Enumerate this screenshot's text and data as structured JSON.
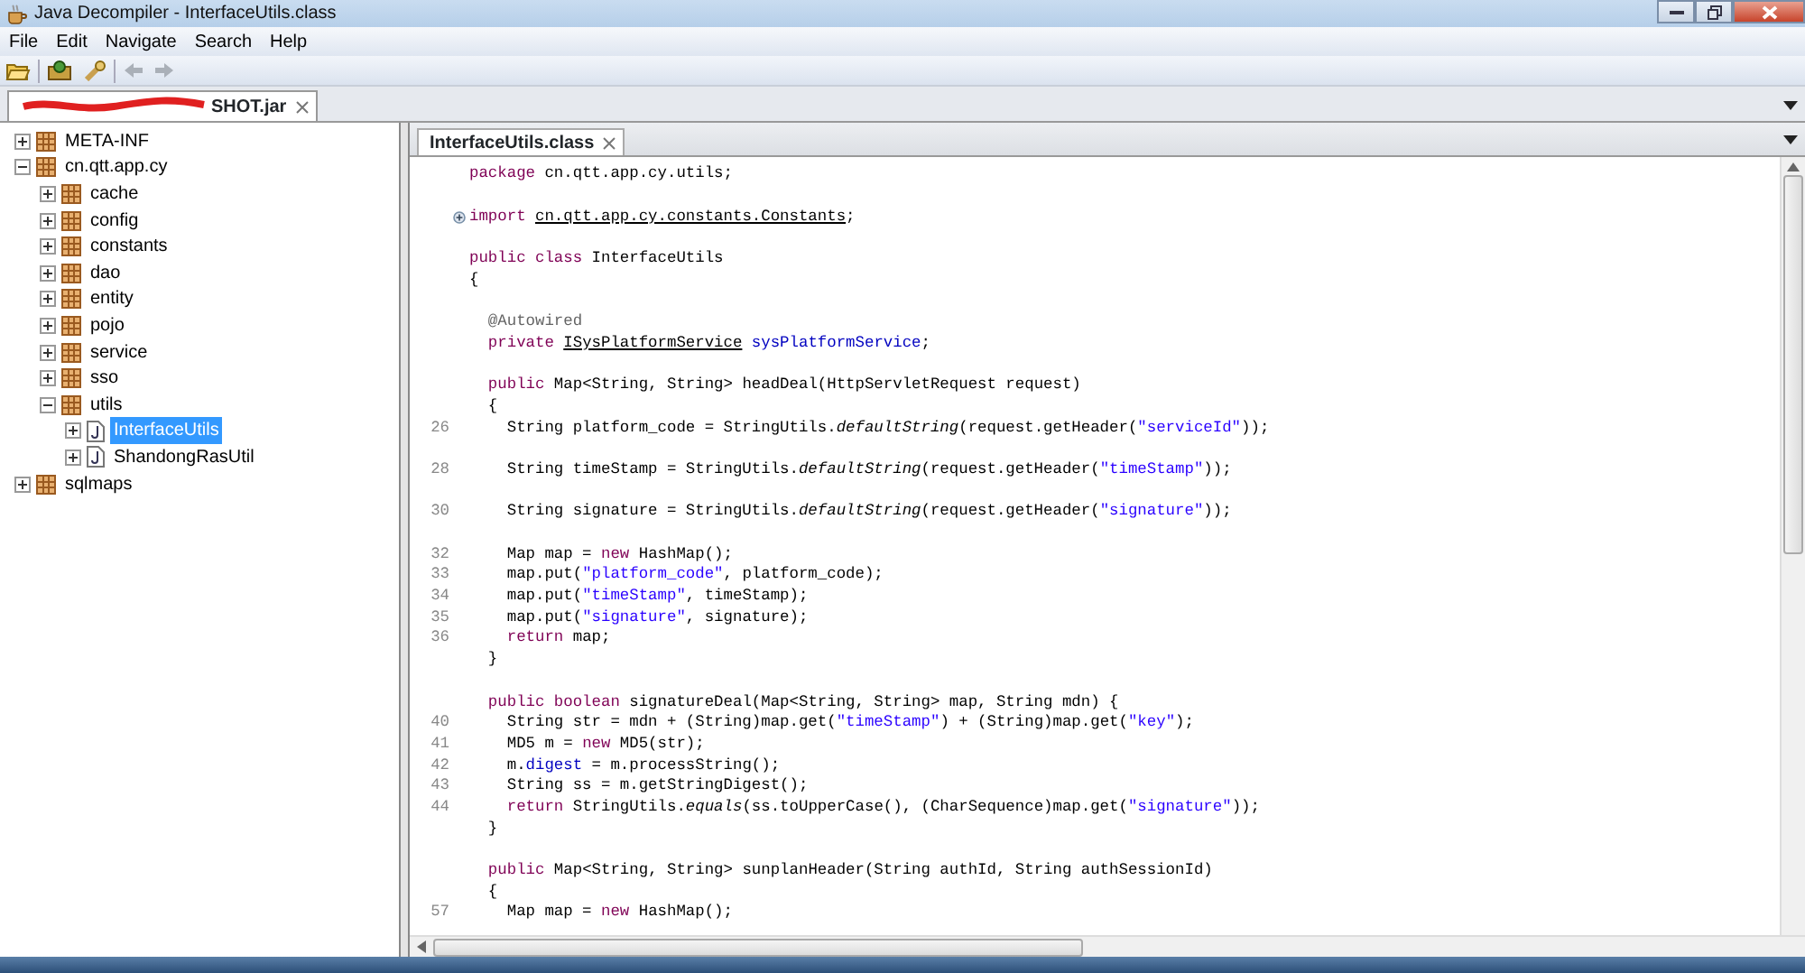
{
  "window": {
    "title": "Java Decompiler - InterfaceUtils.class"
  },
  "menu": [
    "File",
    "Edit",
    "Navigate",
    "Search",
    "Help"
  ],
  "archive_tab": {
    "label": "SHOT.jar",
    "selected": true
  },
  "tree": [
    {
      "label": "META-INF",
      "kind": "package",
      "expanded": false,
      "selected": false
    },
    {
      "label": "cn.qtt.app.cy",
      "kind": "package",
      "expanded": true,
      "selected": false,
      "children": [
        {
          "label": "cache",
          "kind": "package",
          "expanded": false,
          "selected": false
        },
        {
          "label": "config",
          "kind": "package",
          "expanded": false,
          "selected": false
        },
        {
          "label": "constants",
          "kind": "package",
          "expanded": false,
          "selected": false
        },
        {
          "label": "dao",
          "kind": "package",
          "expanded": false,
          "selected": false
        },
        {
          "label": "entity",
          "kind": "package",
          "expanded": false,
          "selected": false
        },
        {
          "label": "pojo",
          "kind": "package",
          "expanded": false,
          "selected": false
        },
        {
          "label": "service",
          "kind": "package",
          "expanded": false,
          "selected": false
        },
        {
          "label": "sso",
          "kind": "package",
          "expanded": false,
          "selected": false
        },
        {
          "label": "utils",
          "kind": "package",
          "expanded": true,
          "selected": false,
          "children": [
            {
              "label": "InterfaceUtils",
              "kind": "class",
              "expanded": false,
              "selected": true
            },
            {
              "label": "ShandongRasUtil",
              "kind": "class",
              "expanded": false,
              "selected": false
            }
          ]
        }
      ]
    },
    {
      "label": "sqlmaps",
      "kind": "package",
      "expanded": false,
      "selected": false
    }
  ],
  "editor_tab": {
    "label": "InterfaceUtils.class",
    "selected": true
  },
  "code_lines": [
    {
      "kind": "code",
      "segments": [
        {
          "kind": "keyword",
          "text": "package"
        },
        {
          "kind": "plain",
          "text": " cn.qtt.app.cy.utils;"
        }
      ]
    },
    {
      "kind": "blank"
    },
    {
      "kind": "folded",
      "segments": [
        {
          "kind": "keyword",
          "text": "import "
        },
        {
          "kind": "reference",
          "text": "cn.qtt.app.cy.constants.Constants"
        },
        {
          "kind": "plain",
          "text": ";"
        }
      ]
    },
    {
      "kind": "blank"
    },
    {
      "kind": "code",
      "segments": [
        {
          "kind": "keyword",
          "text": "public class"
        },
        {
          "kind": "plain",
          "text": " InterfaceUtils"
        }
      ]
    },
    {
      "kind": "code",
      "segments": [
        {
          "kind": "plain",
          "text": "{"
        }
      ]
    },
    {
      "kind": "blank"
    },
    {
      "kind": "code",
      "segments": [
        {
          "kind": "annotation",
          "text": "  @Autowired"
        }
      ]
    },
    {
      "kind": "code",
      "segments": [
        {
          "kind": "keyword",
          "text": "  private "
        },
        {
          "kind": "reference",
          "text": "ISysPlatformService"
        },
        {
          "kind": "field",
          "text": " sysPlatformService"
        },
        {
          "kind": "plain",
          "text": ";"
        }
      ]
    },
    {
      "kind": "blank"
    },
    {
      "kind": "code",
      "segments": [
        {
          "kind": "keyword",
          "text": "  public"
        },
        {
          "kind": "plain",
          "text": " Map<String, String> headDeal(HttpServletRequest request)"
        }
      ]
    },
    {
      "kind": "code",
      "segments": [
        {
          "kind": "plain",
          "text": "  {"
        }
      ]
    },
    {
      "kind": "code",
      "number": "26",
      "segments": [
        {
          "kind": "plain",
          "text": "    String platform_code = StringUtils."
        },
        {
          "kind": "static",
          "text": "defaultString"
        },
        {
          "kind": "plain",
          "text": "(request.getHeader("
        },
        {
          "kind": "string",
          "text": "\"serviceId\""
        },
        {
          "kind": "plain",
          "text": "));"
        }
      ]
    },
    {
      "kind": "blank"
    },
    {
      "kind": "code",
      "number": "28",
      "segments": [
        {
          "kind": "plain",
          "text": "    String timeStamp = StringUtils."
        },
        {
          "kind": "static",
          "text": "defaultString"
        },
        {
          "kind": "plain",
          "text": "(request.getHeader("
        },
        {
          "kind": "string",
          "text": "\"timeStamp\""
        },
        {
          "kind": "plain",
          "text": "));"
        }
      ]
    },
    {
      "kind": "blank"
    },
    {
      "kind": "code",
      "number": "30",
      "segments": [
        {
          "kind": "plain",
          "text": "    String signature = StringUtils."
        },
        {
          "kind": "static",
          "text": "defaultString"
        },
        {
          "kind": "plain",
          "text": "(request.getHeader("
        },
        {
          "kind": "string",
          "text": "\"signature\""
        },
        {
          "kind": "plain",
          "text": "));"
        }
      ]
    },
    {
      "kind": "blank"
    },
    {
      "kind": "code",
      "number": "32",
      "segments": [
        {
          "kind": "plain",
          "text": "    Map map = "
        },
        {
          "kind": "keyword",
          "text": "new"
        },
        {
          "kind": "plain",
          "text": " HashMap();"
        }
      ]
    },
    {
      "kind": "code",
      "number": "33",
      "segments": [
        {
          "kind": "plain",
          "text": "    map.put("
        },
        {
          "kind": "string",
          "text": "\"platform_code\""
        },
        {
          "kind": "plain",
          "text": ", platform_code);"
        }
      ]
    },
    {
      "kind": "code",
      "number": "34",
      "segments": [
        {
          "kind": "plain",
          "text": "    map.put("
        },
        {
          "kind": "string",
          "text": "\"timeStamp\""
        },
        {
          "kind": "plain",
          "text": ", timeStamp);"
        }
      ]
    },
    {
      "kind": "code",
      "number": "35",
      "segments": [
        {
          "kind": "plain",
          "text": "    map.put("
        },
        {
          "kind": "string",
          "text": "\"signature\""
        },
        {
          "kind": "plain",
          "text": ", signature);"
        }
      ]
    },
    {
      "kind": "code",
      "number": "36",
      "segments": [
        {
          "kind": "keyword",
          "text": "    return"
        },
        {
          "kind": "plain",
          "text": " map;"
        }
      ]
    },
    {
      "kind": "code",
      "segments": [
        {
          "kind": "plain",
          "text": "  }"
        }
      ]
    },
    {
      "kind": "blank"
    },
    {
      "kind": "code",
      "segments": [
        {
          "kind": "keyword",
          "text": "  public boolean"
        },
        {
          "kind": "plain",
          "text": " signatureDeal(Map<String, String> map, String mdn) {"
        }
      ]
    },
    {
      "kind": "code",
      "number": "40",
      "segments": [
        {
          "kind": "plain",
          "text": "    String str = mdn + (String)map.get("
        },
        {
          "kind": "string",
          "text": "\"timeStamp\""
        },
        {
          "kind": "plain",
          "text": ") + (String)map.get("
        },
        {
          "kind": "string",
          "text": "\"key\""
        },
        {
          "kind": "plain",
          "text": ");"
        }
      ]
    },
    {
      "kind": "code",
      "number": "41",
      "segments": [
        {
          "kind": "plain",
          "text": "    MD5 m = "
        },
        {
          "kind": "keyword",
          "text": "new"
        },
        {
          "kind": "plain",
          "text": " MD5(str);"
        }
      ]
    },
    {
      "kind": "code",
      "number": "42",
      "segments": [
        {
          "kind": "plain",
          "text": "    m."
        },
        {
          "kind": "field",
          "text": "digest"
        },
        {
          "kind": "plain",
          "text": " = m.processString();"
        }
      ]
    },
    {
      "kind": "code",
      "number": "43",
      "segments": [
        {
          "kind": "plain",
          "text": "    String ss = m.getStringDigest();"
        }
      ]
    },
    {
      "kind": "code",
      "number": "44",
      "segments": [
        {
          "kind": "keyword",
          "text": "    return"
        },
        {
          "kind": "plain",
          "text": " StringUtils."
        },
        {
          "kind": "static",
          "text": "equals"
        },
        {
          "kind": "plain",
          "text": "(ss.toUpperCase(), (CharSequence)map.get("
        },
        {
          "kind": "string",
          "text": "\"signature\""
        },
        {
          "kind": "plain",
          "text": "));"
        }
      ]
    },
    {
      "kind": "code",
      "segments": [
        {
          "kind": "plain",
          "text": "  }"
        }
      ]
    },
    {
      "kind": "blank"
    },
    {
      "kind": "code",
      "segments": [
        {
          "kind": "keyword",
          "text": "  public"
        },
        {
          "kind": "plain",
          "text": " Map<String, String> sunplanHeader(String authId, String authSessionId)"
        }
      ]
    },
    {
      "kind": "code",
      "segments": [
        {
          "kind": "plain",
          "text": "  {"
        }
      ]
    },
    {
      "kind": "code",
      "number": "57",
      "segments": [
        {
          "kind": "plain",
          "text": "    Map map = "
        },
        {
          "kind": "keyword",
          "text": "new"
        },
        {
          "kind": "plain",
          "text": " HashMap();"
        }
      ]
    }
  ]
}
